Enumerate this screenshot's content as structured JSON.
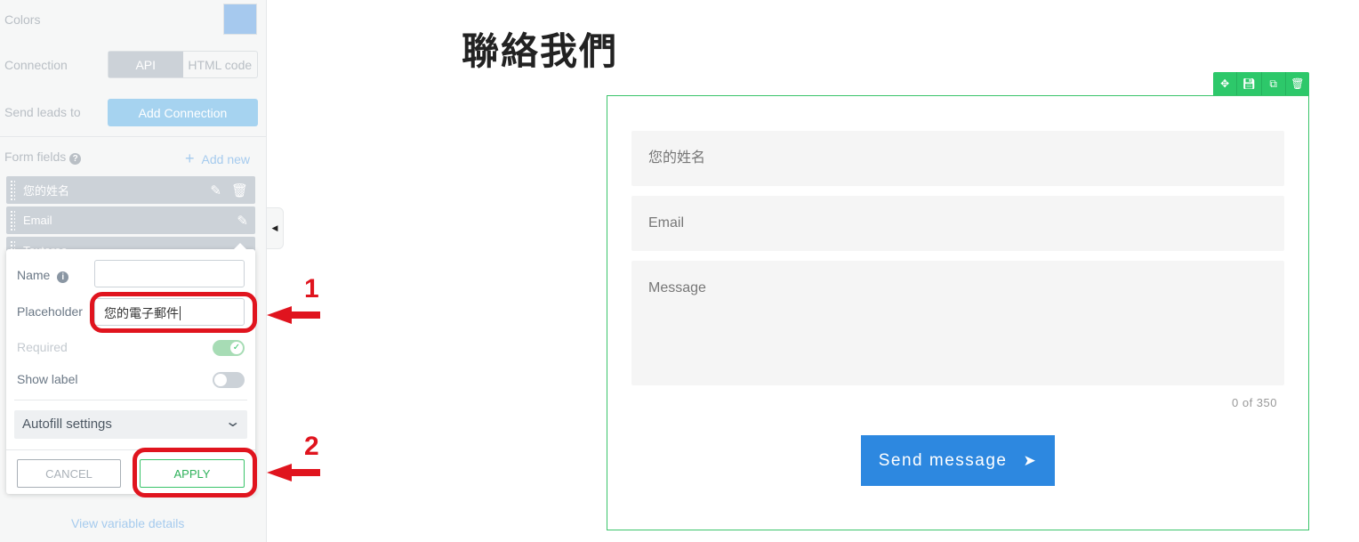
{
  "sidebar": {
    "colors_label": "Colors",
    "color_value": "#a6c9ee",
    "connection_label": "Connection",
    "connection_options": [
      "API",
      "HTML code"
    ],
    "send_leads_label": "Send leads to",
    "add_connection": "Add Connection",
    "form_fields_label": "Form fields",
    "add_new": "Add new",
    "fields": [
      "您的姓名",
      "Email",
      "Textarea"
    ],
    "view_variable_details": "View variable details"
  },
  "popup": {
    "name_label": "Name",
    "name_value": "",
    "placeholder_label": "Placeholder",
    "placeholder_value": "您的電子郵件",
    "required_label": "Required",
    "required_on": true,
    "show_label_label": "Show label",
    "show_label_on": false,
    "autofill": "Autofill settings",
    "cancel": "CANCEL",
    "apply": "APPLY"
  },
  "annotations": {
    "step1": "1",
    "step2": "2"
  },
  "page": {
    "title": "聯絡我們",
    "form": {
      "name_placeholder": "您的姓名",
      "email_placeholder": "Email",
      "message_placeholder": "Message",
      "counter": "0 of 350",
      "send": "Send message"
    }
  },
  "colors": {
    "accent_green": "#2dc86a",
    "button_blue": "#2d88e0",
    "annotation_red": "#e0141e"
  }
}
